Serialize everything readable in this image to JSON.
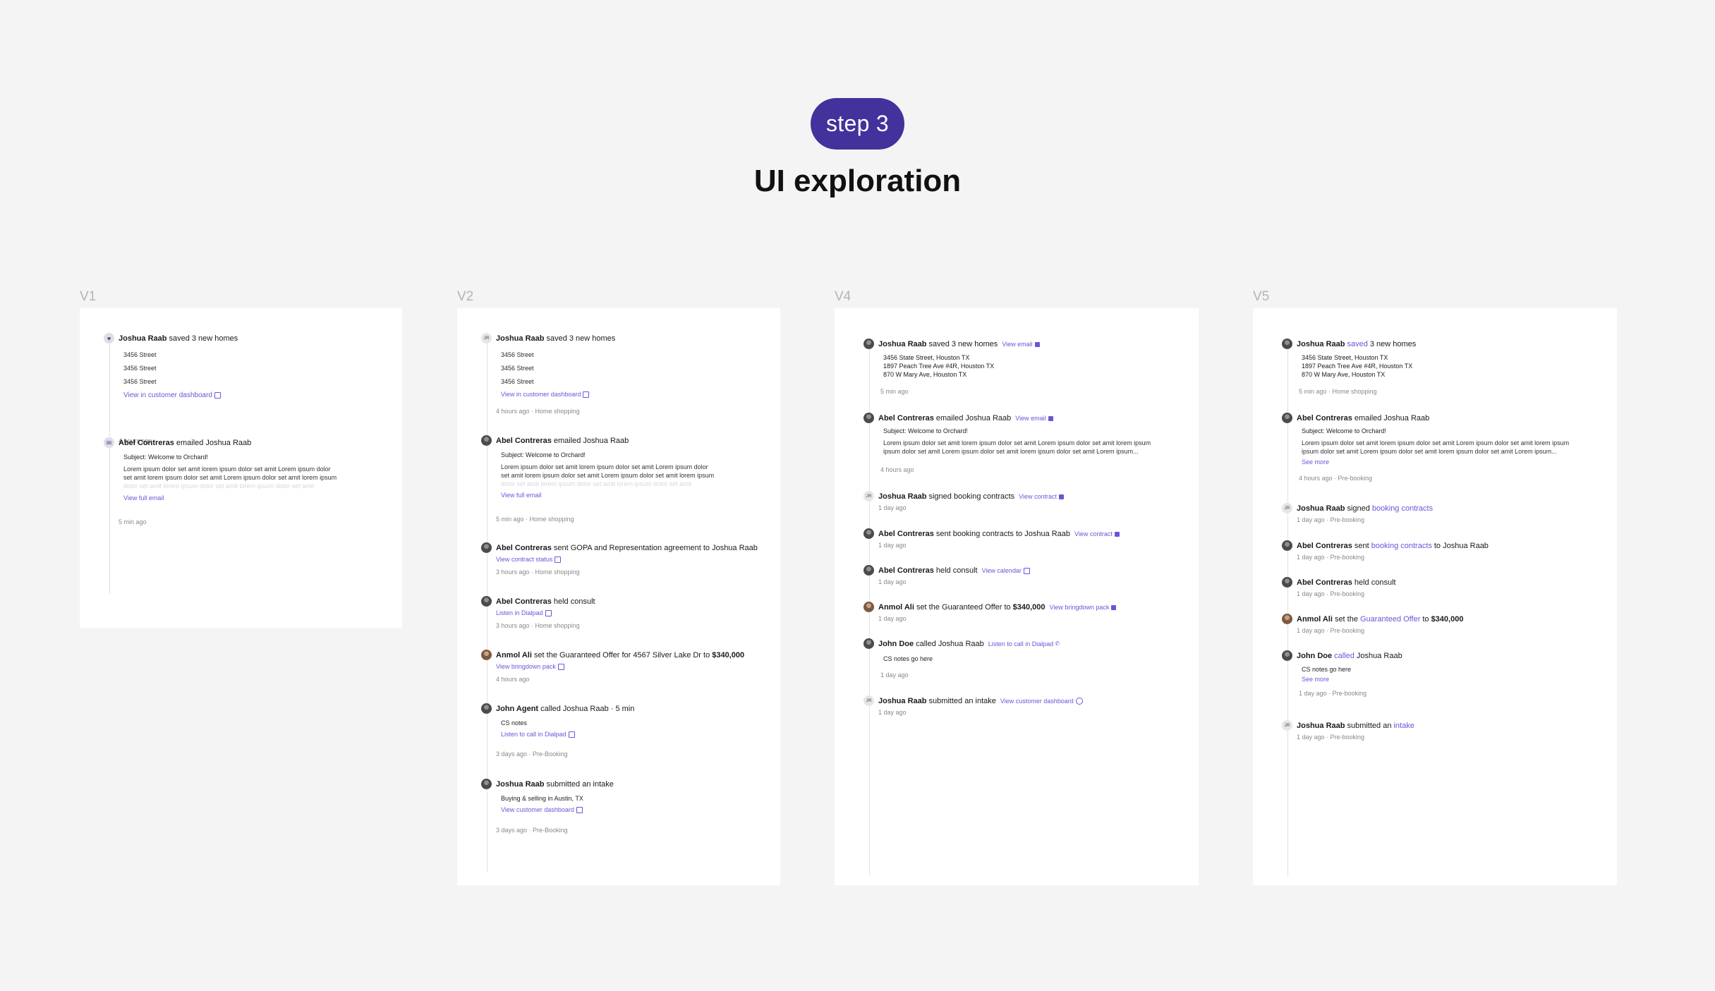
{
  "header": {
    "step_label": "step 3",
    "title": "UI exploration"
  },
  "colors": {
    "accent": "#6a55d8",
    "pill": "#43319c",
    "background": "#f4f4f4"
  },
  "v1": {
    "label": "V1",
    "e1": {
      "actor": "Joshua Raab",
      "action": "saved 3 new homes",
      "addresses": [
        "3456 Street",
        "3456 Street",
        "3456 Street"
      ],
      "link": "View in customer dashboard",
      "time": "4 hours ago"
    },
    "e2": {
      "actor": "Abel Contreras",
      "action": "emailed Joshua Raab",
      "subject": "Subject: Welcome to Orchard!",
      "lorem1": "Lorem ipsum dolor set amit lorem ipsum dolor set amit Lorem ipsum dolor",
      "lorem2": "set amit lorem ipsum dolor set amit Lorem ipsum dolor set amit lorem ipsum",
      "lorem3": "dolor set amit lorem ipsum dolor set amit lorem ipsum dolor set amit",
      "link": "View full email",
      "time": "5 min ago"
    }
  },
  "v2": {
    "label": "V2",
    "e1": {
      "initials": "JR",
      "actor": "Joshua Raab",
      "action": "saved 3 new homes",
      "addresses": [
        "3456 Street",
        "3456 Street",
        "3456 Street"
      ],
      "link": "View in customer dashboard",
      "meta": "4 hours ago · Home shopping"
    },
    "e2": {
      "actor": "Abel Contreras",
      "action": "emailed Joshua Raab",
      "subject": "Subject: Welcome to Orchard!",
      "lorem1": "Lorem ipsum dolor set amit lorem ipsum dolor set amit Lorem ipsum dolor",
      "lorem2": "set amit lorem ipsum dolor set amit Lorem ipsum dolor set amit lorem ipsum",
      "lorem3": "dolor set amit lorem ipsum dolor set amit lorem ipsum dolor set amit",
      "link": "View full email",
      "meta": "5 min ago · Home shopping"
    },
    "e3": {
      "actor": "Abel Contreras",
      "action": "sent GOPA and Representation agreement to Joshua Raab",
      "link": "View contract status",
      "meta": "3 hours ago · Home shopping"
    },
    "e4": {
      "actor": "Abel Contreras",
      "action": "held consult",
      "link": "Listen in Dialpad",
      "meta": "3 hours ago · Home shopping"
    },
    "e5": {
      "actor": "Anmol Ali",
      "action": "set the Guaranteed Offer for 4567 Silver Lake Dr to",
      "amount": "$340,000",
      "link": "View bringdown pack",
      "meta": "4 hours ago"
    },
    "e6": {
      "actor": "John Agent",
      "action": "called Joshua Raab",
      "duration": "·  5 min",
      "notes": "CS notes",
      "link": "Listen to call in Dialpad",
      "meta": "3 days ago · Pre-Booking"
    },
    "e7": {
      "actor": "Joshua Raab",
      "action": "submitted an intake",
      "detail": "Buying & selling in Austin, TX",
      "link": "View customer dashboard",
      "meta": "3 days ago · Pre-Booking"
    }
  },
  "v4": {
    "label": "V4",
    "e1": {
      "actor": "Joshua Raab",
      "action": "saved 3 new homes",
      "link": "View email",
      "addresses": [
        "3456 State Street, Houston TX",
        "1897 Peach Tree Ave #4R, Houston TX",
        "870 W Mary Ave, Houston TX"
      ],
      "time": "5 min ago"
    },
    "e2": {
      "actor": "Abel Contreras",
      "action": "emailed Joshua Raab",
      "link": "View email",
      "subject": "Subject: Welcome to Orchard!",
      "lorem1": "Lorem ipsum dolor set amit lorem ipsum dolor set amit Lorem ipsum dolor set amit lorem ipsum",
      "lorem2": "ipsum dolor set amit Lorem ipsum dolor set amit lorem ipsum dolor set amit Lorem ipsum...",
      "time": "4 hours ago"
    },
    "e3": {
      "initials": "JR",
      "actor": "Joshua Raab",
      "action": "signed booking contracts",
      "link": "View contract",
      "time": "1 day ago"
    },
    "e4": {
      "actor": "Abel Contreras",
      "action": "sent booking contracts to Joshua Raab",
      "link": "View contract",
      "time": "1 day ago"
    },
    "e5": {
      "actor": "Abel Contreras",
      "action": "held consult",
      "link": "View calendar",
      "time": "1 day ago"
    },
    "e6": {
      "actor": "Anmol Ali",
      "action": "set the Guaranteed Offer to",
      "amount": "$340,000",
      "link": "View bringdown pack",
      "time": "1 day ago"
    },
    "e7": {
      "actor": "John Doe",
      "action": "called Joshua Raab",
      "link": "Listen to call in Dialpad",
      "notes": "CS notes go here",
      "time": "1 day ago"
    },
    "e8": {
      "initials": "JR",
      "actor": "Joshua Raab",
      "action": "submitted an intake",
      "link": "View customer dashboard",
      "time": "1 day ago"
    }
  },
  "v5": {
    "label": "V5",
    "e1": {
      "actor": "Joshua Raab",
      "highlight": "saved",
      "action": "3 new homes",
      "addresses": [
        "3456 State Street, Houston TX",
        "1897 Peach Tree Ave #4R, Houston TX",
        "870 W Mary Ave, Houston TX"
      ],
      "meta": "5 min ago · Home shopping"
    },
    "e2": {
      "actor": "Abel Contreras",
      "action": "emailed Joshua Raab",
      "subject": "Subject: Welcome to Orchard!",
      "lorem1": "Lorem ipsum dolor set amit lorem ipsum dolor set amit Lorem ipsum dolor set amit lorem ipsum",
      "lorem2": "ipsum dolor set amit Lorem ipsum dolor set amit lorem ipsum dolor set amit Lorem ipsum...",
      "link": "See more",
      "meta": "4 hours ago · Pre-booking"
    },
    "e3": {
      "initials": "JR",
      "actor": "Joshua Raab",
      "action": "signed",
      "highlight": "booking contracts",
      "meta": "1 day ago · Pre-booking"
    },
    "e4": {
      "actor": "Abel Contreras",
      "action": "sent",
      "highlight": "booking contracts",
      "tail": "to Joshua Raab",
      "meta": "1 day ago · Pre-booking"
    },
    "e5": {
      "actor": "Abel Contreras",
      "action": "held consult",
      "meta": "1 day ago · Pre-booking"
    },
    "e6": {
      "actor": "Anmol Ali",
      "action": "set the",
      "highlight": "Guaranteed Offer",
      "tail": "to",
      "amount": "$340,000",
      "meta": "1 day ago · Pre-booking"
    },
    "e7": {
      "actor": "John Doe",
      "highlight": "called",
      "action": "Joshua Raab",
      "notes": "CS notes go here",
      "link": "See more",
      "meta": "1 day ago · Pre-booking"
    },
    "e8": {
      "initials": "JR",
      "actor": "Joshua Raab",
      "action": "submitted an",
      "highlight": "intake",
      "meta": "1 day ago · Pre-booking"
    }
  }
}
